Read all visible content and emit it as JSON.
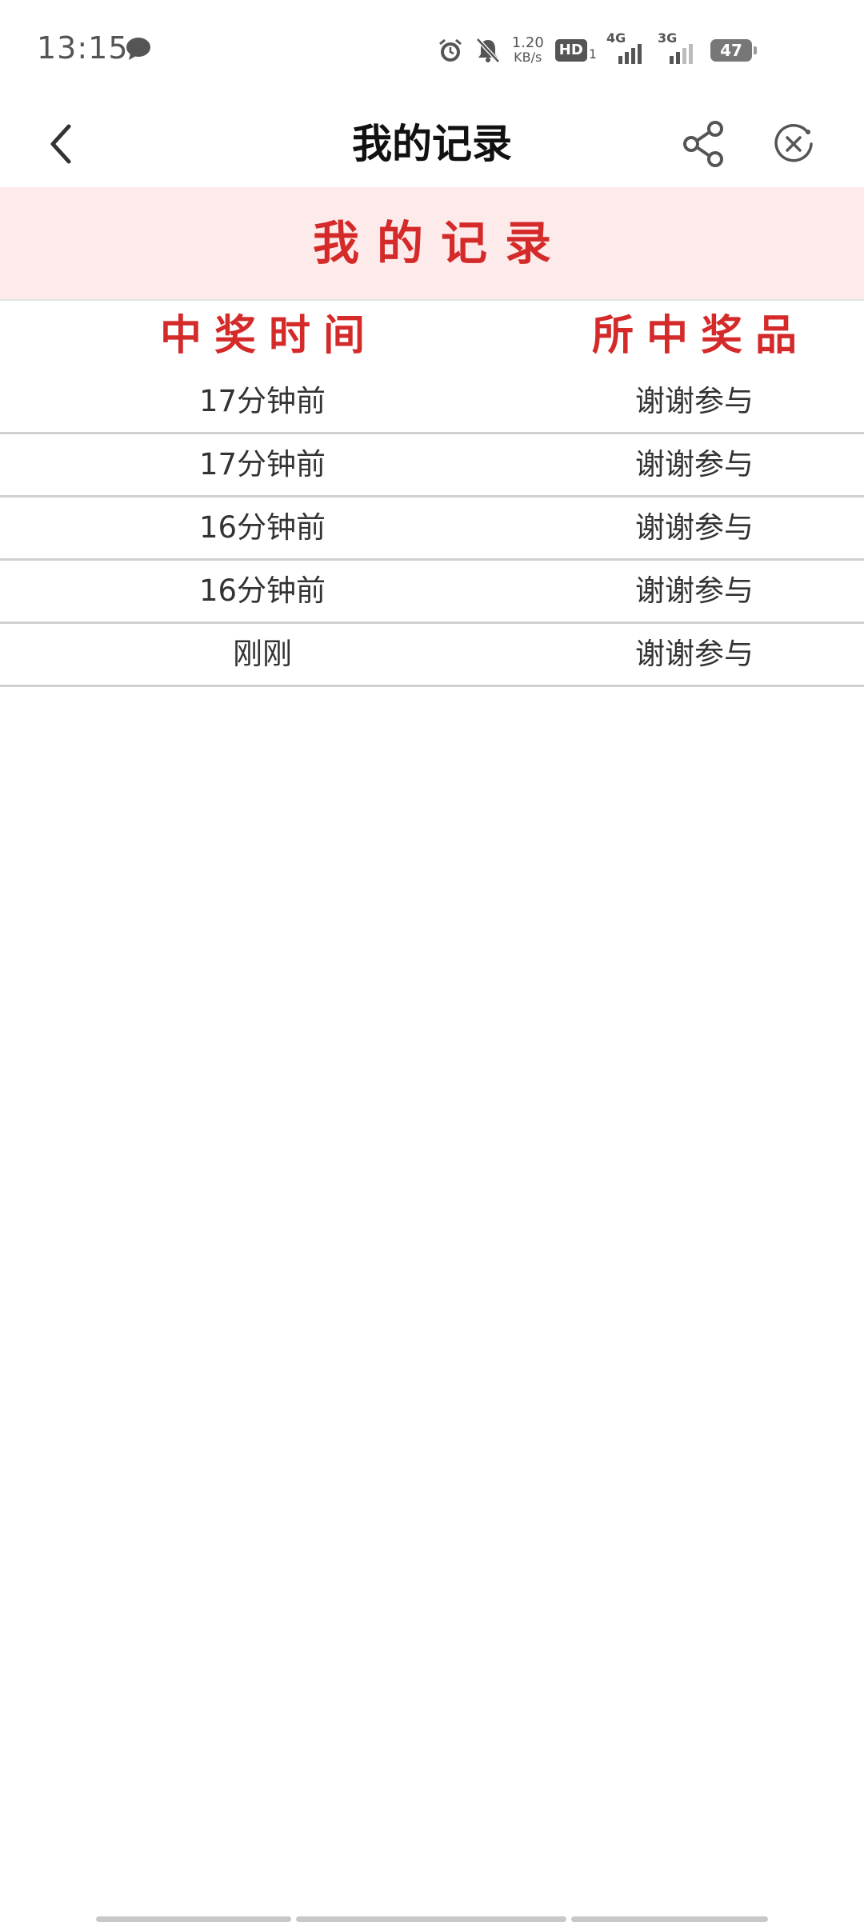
{
  "status_bar": {
    "time": "13:15",
    "net_speed_value": "1.20",
    "net_speed_unit": "KB/s",
    "hd_label": "HD",
    "hd_sub": "1",
    "signal1_label": "4G",
    "signal2_label": "3G",
    "battery": "47"
  },
  "nav": {
    "title": "我的记录"
  },
  "banner": {
    "title": "我的记录"
  },
  "table": {
    "headers": {
      "time": "中奖时间",
      "prize": "所中奖品"
    },
    "rows": [
      {
        "time": "17分钟前",
        "prize": "谢谢参与"
      },
      {
        "time": "17分钟前",
        "prize": "谢谢参与"
      },
      {
        "time": "16分钟前",
        "prize": "谢谢参与"
      },
      {
        "time": "16分钟前",
        "prize": "谢谢参与"
      },
      {
        "time": "刚刚",
        "prize": "谢谢参与"
      }
    ]
  },
  "icons": {
    "chat": "chat-bubble-icon",
    "alarm": "alarm-icon",
    "mute": "bell-off-icon",
    "back": "chevron-left-icon",
    "share": "share-icon",
    "close": "close-circle-icon"
  },
  "colors": {
    "accent": "#d42a2a",
    "banner_bg": "#fdeaea",
    "divider": "#d0d0d0"
  }
}
